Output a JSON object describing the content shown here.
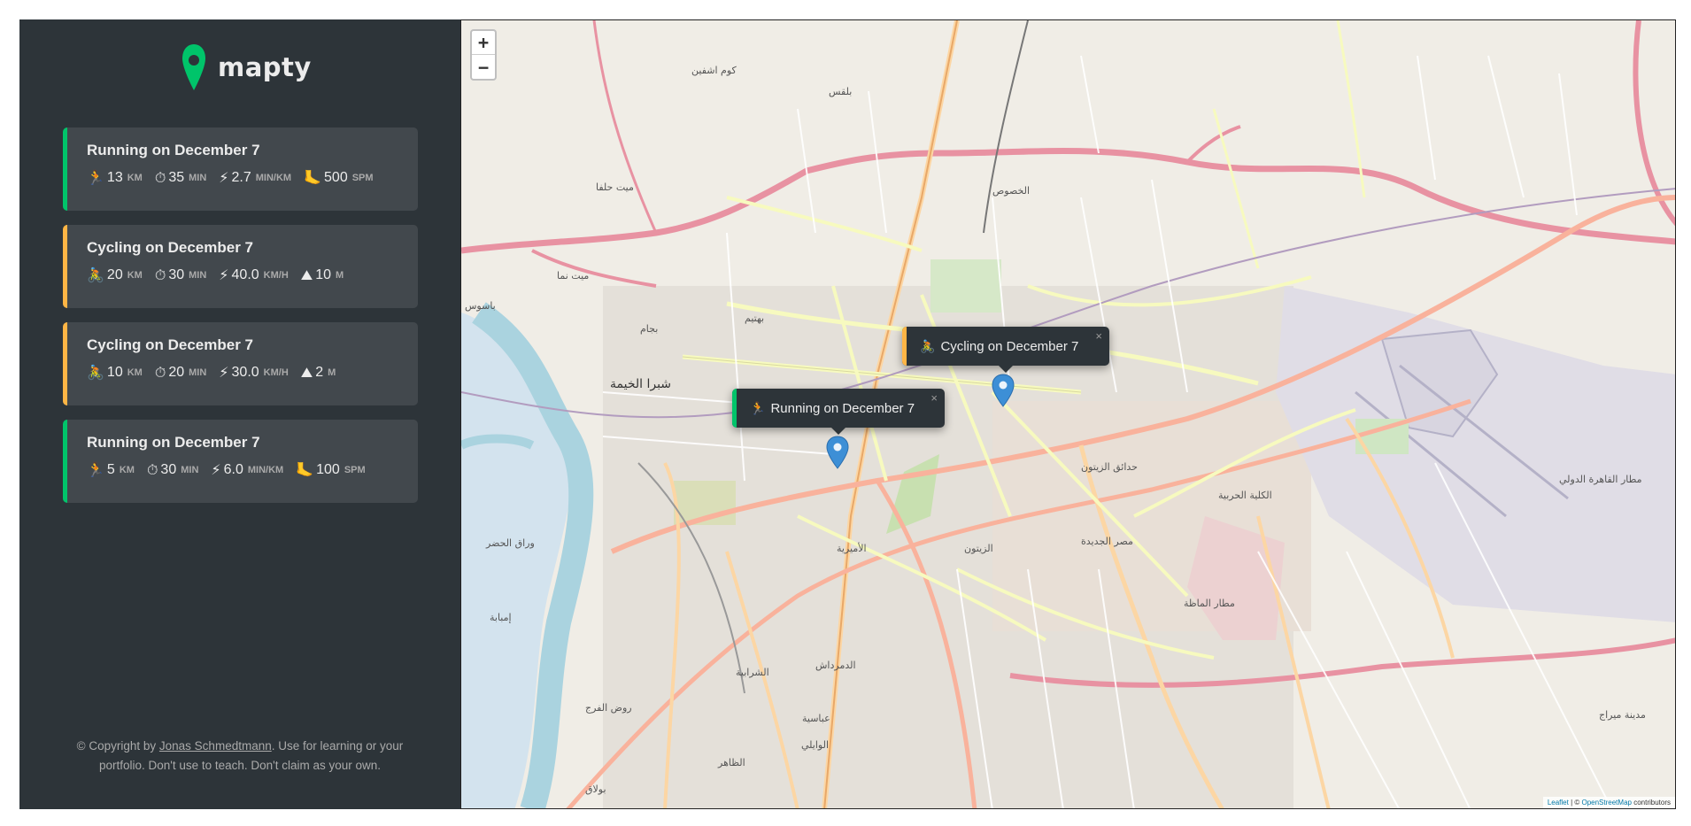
{
  "app": {
    "logo_text": "mapty"
  },
  "workouts": [
    {
      "type": "running",
      "title": "Running on December 7",
      "details": [
        {
          "icon": "🏃",
          "icon_name": "runner-icon",
          "value": "13",
          "unit": "km"
        },
        {
          "icon": "⏱",
          "icon_name": "stopwatch-icon",
          "value": "35",
          "unit": "min"
        },
        {
          "icon": "⚡",
          "icon_name": "lightning-icon",
          "value": "2.7",
          "unit": "min/km"
        },
        {
          "icon": "🦶",
          "icon_name": "foot-icon",
          "value": "500",
          "unit": "spm"
        }
      ]
    },
    {
      "type": "cycling",
      "title": "Cycling on December 7",
      "details": [
        {
          "icon": "🚴",
          "icon_name": "cyclist-icon",
          "value": "20",
          "unit": "km"
        },
        {
          "icon": "⏱",
          "icon_name": "stopwatch-icon",
          "value": "30",
          "unit": "min"
        },
        {
          "icon": "⚡",
          "icon_name": "lightning-icon",
          "value": "40.0",
          "unit": "km/h"
        },
        {
          "icon": "⛰",
          "icon_name": "mountain-icon",
          "value": "10",
          "unit": "m"
        }
      ]
    },
    {
      "type": "cycling",
      "title": "Cycling on December 7",
      "details": [
        {
          "icon": "🚴",
          "icon_name": "cyclist-icon",
          "value": "10",
          "unit": "km"
        },
        {
          "icon": "⏱",
          "icon_name": "stopwatch-icon",
          "value": "20",
          "unit": "min"
        },
        {
          "icon": "⚡",
          "icon_name": "lightning-icon",
          "value": "30.0",
          "unit": "km/h"
        },
        {
          "icon": "⛰",
          "icon_name": "mountain-icon",
          "value": "2",
          "unit": "m"
        }
      ]
    },
    {
      "type": "running",
      "title": "Running on December 7",
      "details": [
        {
          "icon": "🏃",
          "icon_name": "runner-icon",
          "value": "5",
          "unit": "km"
        },
        {
          "icon": "⏱",
          "icon_name": "stopwatch-icon",
          "value": "30",
          "unit": "min"
        },
        {
          "icon": "⚡",
          "icon_name": "lightning-icon",
          "value": "6.0",
          "unit": "min/km"
        },
        {
          "icon": "🦶",
          "icon_name": "foot-icon",
          "value": "100",
          "unit": "spm"
        }
      ]
    }
  ],
  "footer": {
    "prefix": "© Copyright by ",
    "author": "Jonas Schmedtmann",
    "suffix": ". Use for learning or your portfolio. Don't use to teach. Don't claim as your own."
  },
  "map": {
    "zoom_in": "+",
    "zoom_out": "−",
    "popups": [
      {
        "type": "cycling",
        "icon": "🚴",
        "label": "Cycling on December 7",
        "close": "×"
      },
      {
        "type": "running",
        "icon": "🏃",
        "label": "Running on December 7",
        "close": "×"
      }
    ],
    "attribution": {
      "leaflet": "Leaflet",
      "sep": " | © ",
      "osm": "OpenStreetMap",
      "suffix": " contributors"
    },
    "place_labels": [
      "شبرا الخيمة",
      "الأميرية",
      "الزيتون",
      "مصر الجديدة",
      "حدائق الزيتون",
      "الخصوص",
      "بهتيم",
      "مطار القاهرة الدولي",
      "الدمرداش",
      "الشرابية",
      "روض الفرج",
      "إمبابة",
      "وراق الحضر",
      "بلقس",
      "كوم اشفين",
      "ميت حلفا",
      "ميت نما",
      "بجام",
      "باسوس",
      "مطار الماظة",
      "الكلية الحربية",
      "الوايلي",
      "الظاهر",
      "بولاق",
      "عباسية",
      "مدينة ميراج"
    ]
  },
  "colors": {
    "sidebar_bg": "#2d3439",
    "card_bg": "#42484d",
    "running": "#00c46a",
    "cycling": "#ffb545",
    "text": "#ececec"
  }
}
